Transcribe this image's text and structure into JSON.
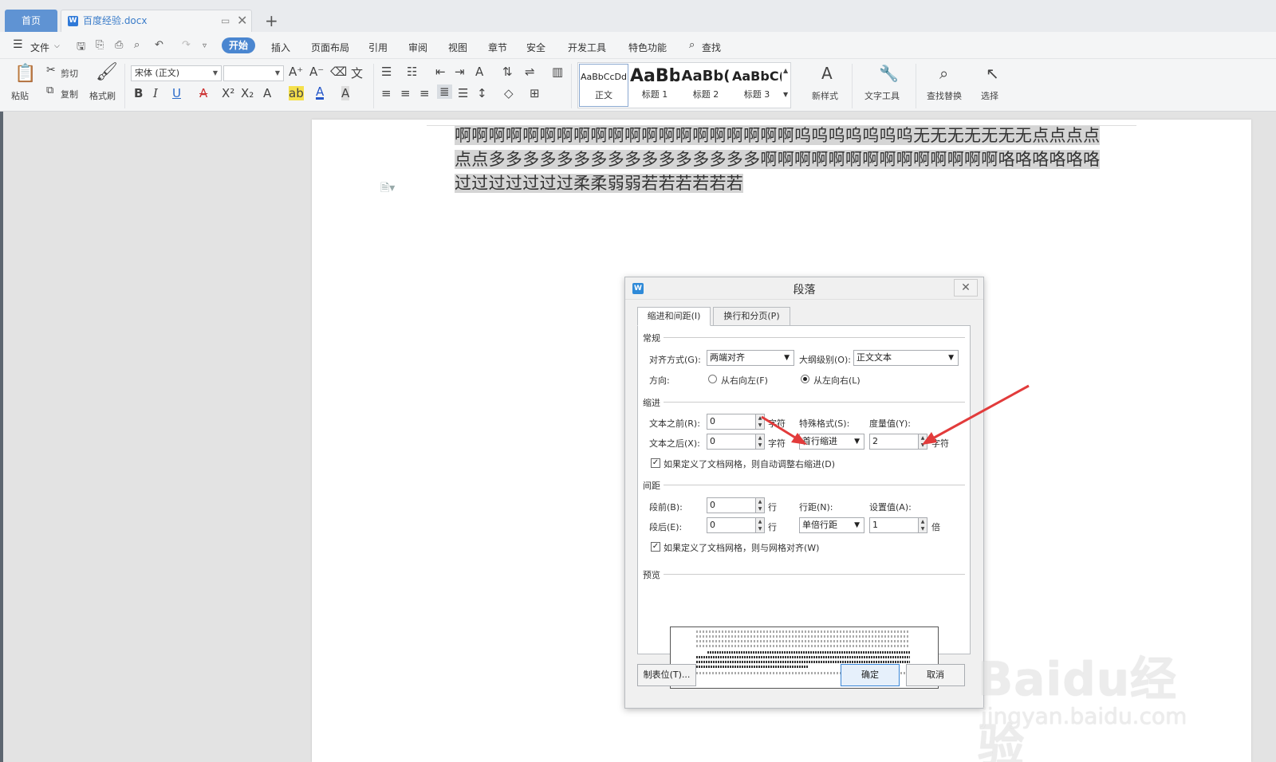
{
  "tabs": {
    "home": "首页",
    "doc": "百度经验.docx"
  },
  "menu": {
    "file": "文件",
    "items": [
      "开始",
      "插入",
      "页面布局",
      "引用",
      "审阅",
      "视图",
      "章节",
      "安全",
      "开发工具",
      "特色功能",
      "查找"
    ]
  },
  "ribbon": {
    "paste": "粘贴",
    "cut": "剪切",
    "copy": "复制",
    "format_painter": "格式刷",
    "font_name": "宋体 (正文)",
    "font_size": "",
    "styles": [
      {
        "preview": "AaBbCcDd",
        "name": "正文"
      },
      {
        "preview": "AaBb",
        "name": "标题 1"
      },
      {
        "preview": "AaBb(",
        "name": "标题 2"
      },
      {
        "preview": "AaBbC(",
        "name": "标题 3"
      }
    ],
    "new_style": "新样式",
    "text_tools": "文字工具",
    "find_replace": "查找替换",
    "select": "选择"
  },
  "document": {
    "text": "啊啊啊啊啊啊啊啊啊啊啊啊啊啊啊啊啊啊啊啊呜呜呜呜呜呜呜无无无无无无无点点点点点点多多多多多多多多多多多多多多多多啊啊啊啊啊啊啊啊啊啊啊啊啊啊咯咯咯咯咯咯过过过过过过过柔柔弱弱若若若若若若"
  },
  "dialog": {
    "title": "段落",
    "tabs": [
      "缩进和间距(I)",
      "换行和分页(P)"
    ],
    "general": {
      "section": "常规",
      "align_label": "对齐方式(G):",
      "align_value": "两端对齐",
      "outline_label": "大纲级别(O):",
      "outline_value": "正文文本",
      "direction_label": "方向:",
      "rtl": "从右向左(F)",
      "ltr": "从左向右(L)"
    },
    "indent": {
      "section": "缩进",
      "before_label": "文本之前(R):",
      "before_value": "0",
      "after_label": "文本之后(X):",
      "after_value": "0",
      "unit": "字符",
      "special_label": "特殊格式(S):",
      "special_value": "首行缩进",
      "measure_label": "度量值(Y):",
      "measure_value": "2",
      "auto_adjust": "如果定义了文档网格，则自动调整右缩进(D)"
    },
    "spacing": {
      "section": "间距",
      "before_label": "段前(B):",
      "before_value": "0",
      "after_label": "段后(E):",
      "after_value": "0",
      "unit": "行",
      "line_label": "行距(N):",
      "line_value": "单倍行距",
      "setting_label": "设置值(A):",
      "setting_value": "1",
      "setting_unit": "倍",
      "grid_align": "如果定义了文档网格，则与网格对齐(W)"
    },
    "preview_section": "预览",
    "buttons": {
      "tabs": "制表位(T)...",
      "ok": "确定",
      "cancel": "取消"
    }
  },
  "watermark": {
    "brand": "Baidu经验",
    "url": "jingyan.baidu.com"
  }
}
